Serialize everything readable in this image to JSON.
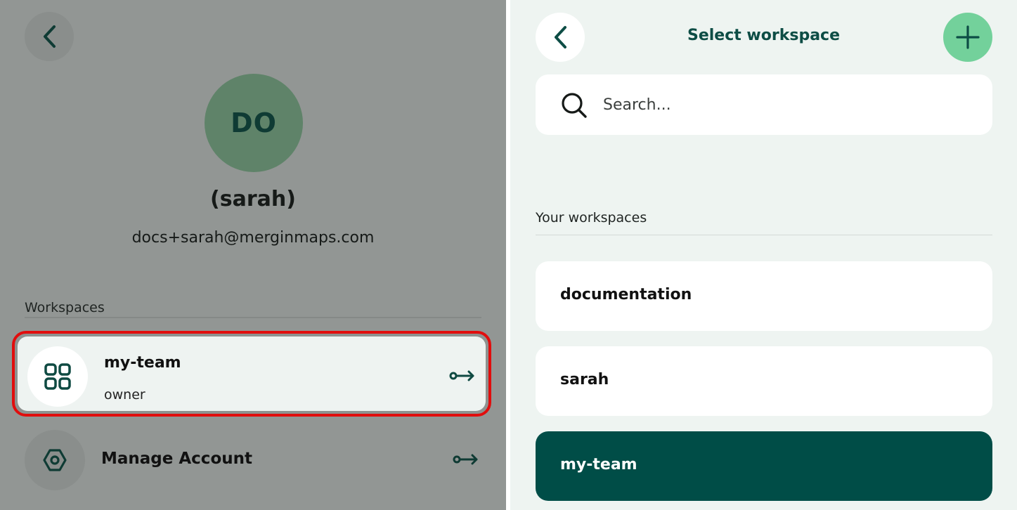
{
  "profile": {
    "initials": "DO",
    "name": "(sarah)",
    "email": "docs+sarah@merginmaps.com",
    "workspaces_heading": "Workspaces",
    "current_workspace": {
      "name": "my-team",
      "role": "owner"
    },
    "manage_account_label": "Manage Account"
  },
  "selector": {
    "title": "Select workspace",
    "search_placeholder": "Search...",
    "list_heading": "Your workspaces",
    "workspaces": [
      {
        "name": "documentation"
      },
      {
        "name": "sarah"
      },
      {
        "name": "my-team"
      }
    ]
  },
  "colors": {
    "accent_dark": "#004d47",
    "accent_light": "#73d19b",
    "highlight_border": "#e10d0d",
    "avatar_bg": "#5f8369"
  },
  "icons": {
    "back": "chevron-left-icon",
    "workspace": "grid-icon",
    "navigate": "arrow-right-icon",
    "manage": "hexagon-settings-icon",
    "add": "plus-icon",
    "search": "search-icon"
  }
}
